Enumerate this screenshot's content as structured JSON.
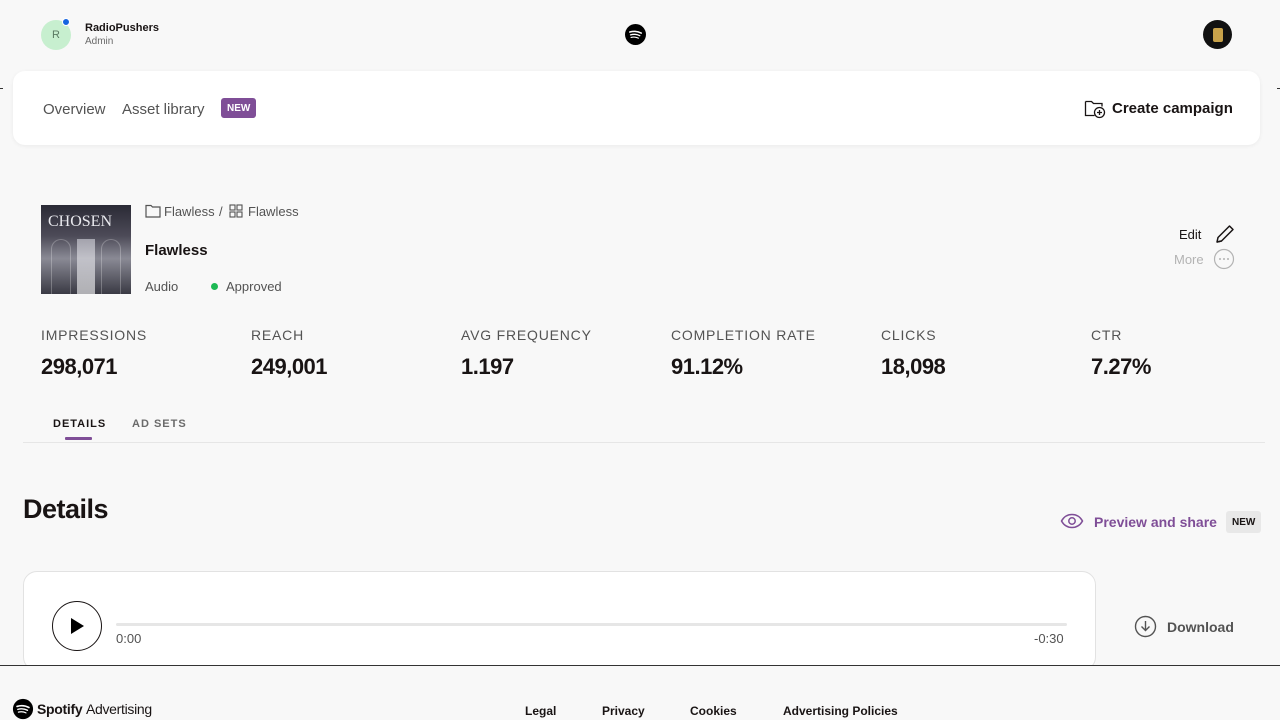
{
  "account": {
    "avatar_initial": "R",
    "name": "RadioPushers",
    "role": "Admin"
  },
  "nav": {
    "overview": "Overview",
    "asset_library": "Asset library",
    "new_badge": "NEW",
    "create_campaign": "Create campaign"
  },
  "asset": {
    "cover_text": "CHOSEN",
    "breadcrumb": [
      "Flawless",
      "Flawless"
    ],
    "breadcrumb_separator": "/",
    "title": "Flawless",
    "type": "Audio",
    "status": "Approved",
    "edit_label": "Edit",
    "more_label": "More"
  },
  "stats": [
    {
      "label": "IMPRESSIONS",
      "value": "298,071"
    },
    {
      "label": "REACH",
      "value": "249,001"
    },
    {
      "label": "AVG FREQUENCY",
      "value": "1.197"
    },
    {
      "label": "COMPLETION RATE",
      "value": "91.12%"
    },
    {
      "label": "CLICKS",
      "value": "18,098"
    },
    {
      "label": "CTR",
      "value": "7.27%"
    }
  ],
  "tabs": [
    {
      "label": "DETAILS",
      "active": true
    },
    {
      "label": "AD SETS",
      "active": false
    }
  ],
  "details": {
    "heading": "Details",
    "preview_share": "Preview and share",
    "new_badge": "NEW",
    "player": {
      "time_elapsed": "0:00",
      "time_remaining": "-0:30",
      "progress": 0
    },
    "download": "Download"
  },
  "footer": {
    "brand_bold": "Spotify",
    "brand_light": "Advertising",
    "links": [
      "Legal",
      "Privacy",
      "Cookies",
      "Advertising Policies"
    ]
  },
  "colors": {
    "accent": "#7f4e97",
    "status_approved": "#1db954",
    "notification_dot": "#1565e0"
  }
}
